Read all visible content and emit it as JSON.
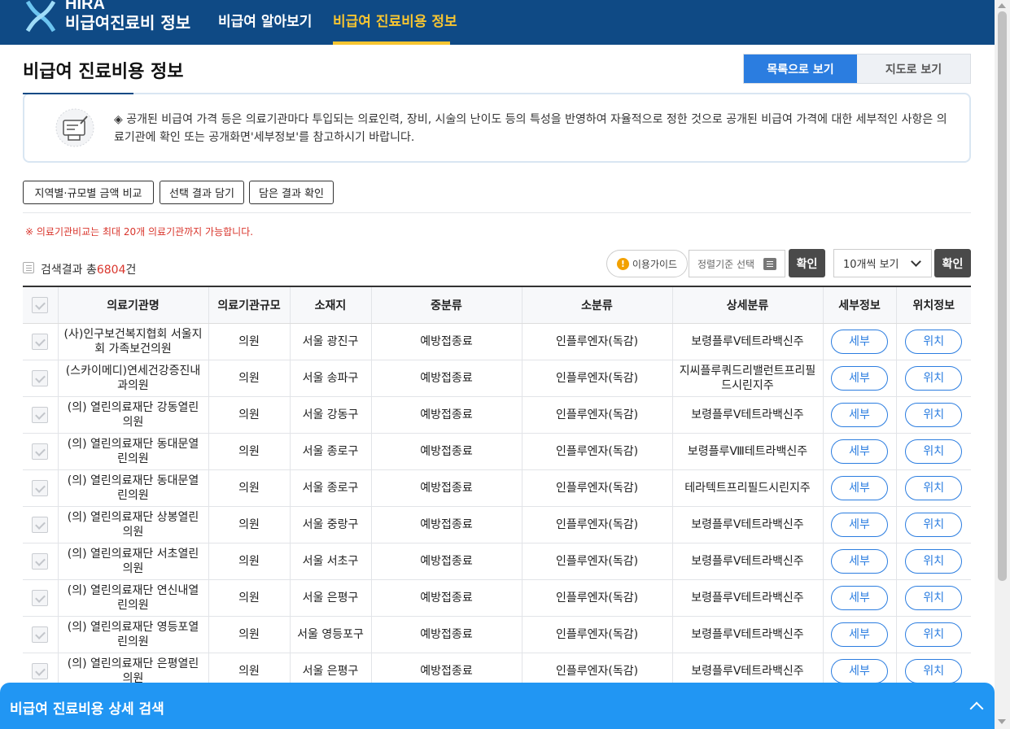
{
  "header": {
    "logo_en": "HIRA",
    "logo_ko": "비급여진료비 정보",
    "nav": [
      "비급여 알아보기",
      "비급여 진료비용 정보"
    ],
    "accent": "#f7c531",
    "bg": "#0f4a85"
  },
  "page": {
    "title": "비급여 진료비용 정보",
    "view_list": "목록으로 보기",
    "view_map": "지도로 보기"
  },
  "notice": {
    "text": "◈ 공개된 비급여 가격 등은 의료기관마다 투입되는 의료인력, 장비, 시술의 난이도 등의 특성을 반영하여 자율적으로 정한 것으로 공개된 비급여 가격에 대한 세부적인 사항은 의료기관에 확인 또는 공개화면'세부정보'를 참고하시기 바랍니다.",
    "icon": "document-pen-icon"
  },
  "actions": [
    "지역별·규모별 금액 비교",
    "선택 결과 담기",
    "담은 결과 확인"
  ],
  "warning": "※ 의료기관비교는 최대 20개 의료기관까지 가능합니다.",
  "results": {
    "prefix": "검색결과 총",
    "count": "6804",
    "suffix": "건"
  },
  "controls": {
    "guide": "이용가이드",
    "sort_placeholder": "정렬기준 선택",
    "confirm": "확인",
    "page_size": "10개씩 보기"
  },
  "table": {
    "headers": [
      "의료기관명",
      "의료기관규모",
      "소재지",
      "중분류",
      "소분류",
      "상세분류",
      "세부정보",
      "위치정보"
    ],
    "detail_btn": "세부",
    "location_btn": "위치",
    "rows": [
      {
        "name": "(사)인구보건복지협회 서울지회 가족보건의원",
        "size": "의원",
        "loc": "서울 광진구",
        "mid": "예방접종료",
        "sub": "인플루엔자(독감)",
        "detail": "보령플루Ⅴ테트라백신주"
      },
      {
        "name": "(스카이메디)연세건강증진내과의원",
        "size": "의원",
        "loc": "서울 송파구",
        "mid": "예방접종료",
        "sub": "인플루엔자(독감)",
        "detail": "지씨플루쿼드리밸런트프리필드시린지주"
      },
      {
        "name": "(의) 열린의료재단 강동열린의원",
        "size": "의원",
        "loc": "서울 강동구",
        "mid": "예방접종료",
        "sub": "인플루엔자(독감)",
        "detail": "보령플루Ⅴ테트라백신주"
      },
      {
        "name": "(의) 열린의료재단 동대문열린의원",
        "size": "의원",
        "loc": "서울 종로구",
        "mid": "예방접종료",
        "sub": "인플루엔자(독감)",
        "detail": "보령플루Ⅷ테트라백신주"
      },
      {
        "name": "(의) 열린의료재단 동대문열린의원",
        "size": "의원",
        "loc": "서울 종로구",
        "mid": "예방접종료",
        "sub": "인플루엔자(독감)",
        "detail": "테라텍트프리필드시린지주"
      },
      {
        "name": "(의) 열린의료재단 상봉열린의원",
        "size": "의원",
        "loc": "서울 중랑구",
        "mid": "예방접종료",
        "sub": "인플루엔자(독감)",
        "detail": "보령플루Ⅴ테트라백신주"
      },
      {
        "name": "(의) 열린의료재단 서초열린의원",
        "size": "의원",
        "loc": "서울 서초구",
        "mid": "예방접종료",
        "sub": "인플루엔자(독감)",
        "detail": "보령플루Ⅴ테트라백신주"
      },
      {
        "name": "(의) 열린의료재단 연신내열린의원",
        "size": "의원",
        "loc": "서울 은평구",
        "mid": "예방접종료",
        "sub": "인플루엔자(독감)",
        "detail": "보령플루Ⅴ테트라백신주"
      },
      {
        "name": "(의) 열린의료재단 영등포열린의원",
        "size": "의원",
        "loc": "서울 영등포구",
        "mid": "예방접종료",
        "sub": "인플루엔자(독감)",
        "detail": "보령플루Ⅴ테트라백신주"
      },
      {
        "name": "(의) 열린의료재단 은평열린의원",
        "size": "의원",
        "loc": "서울 은평구",
        "mid": "예방접종료",
        "sub": "인플루엔자(독감)",
        "detail": "보령플루Ⅴ테트라백신주"
      }
    ]
  },
  "bottom_panel": {
    "title": "비급여 진료비용 상세 검색"
  }
}
